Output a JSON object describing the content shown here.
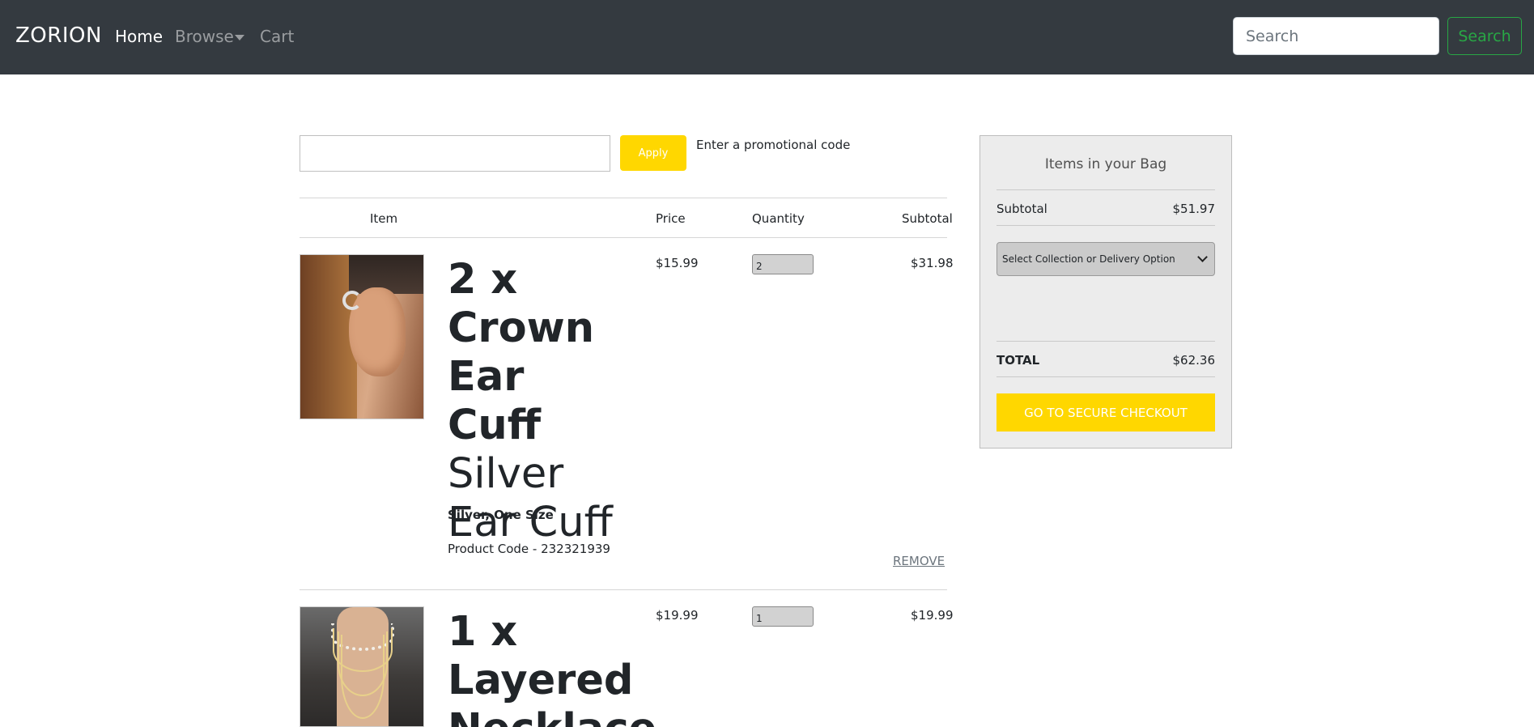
{
  "navbar": {
    "brand": "ZORION",
    "links": {
      "home": "Home",
      "browse": "Browse",
      "cart": "Cart"
    },
    "search_placeholder": "Search",
    "search_button": "Search"
  },
  "promo": {
    "apply_label": "Apply",
    "hint": "Enter a promotional code",
    "value": ""
  },
  "table": {
    "headers": {
      "item": "Item",
      "price": "Price",
      "quantity": "Quantity",
      "subtotal": "Subtotal"
    },
    "rows": [
      {
        "qty_prefix": "2 x",
        "name_bold": "Crown Ear Cuff",
        "name_regular": "Silver Ear Cuff",
        "variant": "Silver, One Size",
        "product_code": "Product Code - 232321939",
        "price": "$15.99",
        "quantity": "2",
        "subtotal": "$31.98",
        "remove_label": "REMOVE",
        "image_icon": "ear-cuff-photo"
      },
      {
        "qty_prefix": "1 x",
        "name_bold": "Layered Necklace",
        "price": "$19.99",
        "quantity": "1",
        "subtotal": "$19.99",
        "image_icon": "layered-necklace-photo"
      }
    ]
  },
  "summary": {
    "title": "Items in your Bag",
    "subtotal_label": "Subtotal",
    "subtotal_value": "$51.97",
    "delivery_select": "Select Collection or Delivery Option",
    "total_label": "TOTAL",
    "total_value": "$62.36",
    "checkout_label": "GO TO SECURE CHECKOUT"
  },
  "colors": {
    "navbar_bg": "#343a40",
    "accent_yellow": "#ffd700",
    "search_green": "#28a745",
    "summary_bg": "#ececec"
  }
}
